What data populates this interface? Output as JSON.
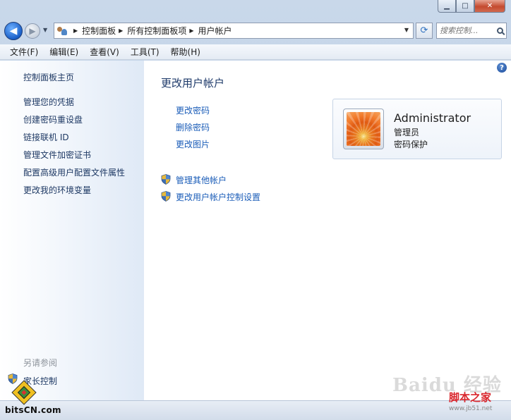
{
  "window": {
    "caption": {
      "minimize": "▁",
      "maximize": "□",
      "close": "✕"
    }
  },
  "navbar": {
    "back_glyph": "◀",
    "forward_glyph": "▶",
    "breadcrumbs": [
      "控制面板",
      "所有控制面板项",
      "用户帐户"
    ],
    "search_placeholder": "搜索控制...",
    "refresh_glyph": "⟳"
  },
  "menubar": {
    "items": [
      "文件(F)",
      "编辑(E)",
      "查看(V)",
      "工具(T)",
      "帮助(H)"
    ]
  },
  "sidebar": {
    "home_link": "控制面板主页",
    "links": [
      "管理您的凭据",
      "创建密码重设盘",
      "链接联机 ID",
      "管理文件加密证书",
      "配置高级用户配置文件属性",
      "更改我的环境变量"
    ],
    "see_also_title": "另请参阅",
    "see_also_links": [
      "家长控制"
    ]
  },
  "main": {
    "help_glyph": "?",
    "title": "更改用户帐户",
    "tasks": [
      "更改密码",
      "删除密码",
      "更改图片"
    ],
    "shield_tasks": [
      "管理其他帐户",
      "更改用户帐户控制设置"
    ]
  },
  "account": {
    "name": "Administrator",
    "role": "管理员",
    "status": "密码保护"
  },
  "watermarks": {
    "bits": "bitsCN.com",
    "baidu": "Baidu 经验",
    "jb": "脚本之家",
    "jb_url": "www.jb51.net"
  },
  "icons": {
    "shield": "uac-shield-icon",
    "users": "users-icon",
    "search": "search-icon",
    "help": "help-icon"
  },
  "colors": {
    "link": "#1a5cb8",
    "title": "#1e3a6a",
    "sidebar_link": "#1e3964",
    "close_button": "#c44a2f"
  }
}
